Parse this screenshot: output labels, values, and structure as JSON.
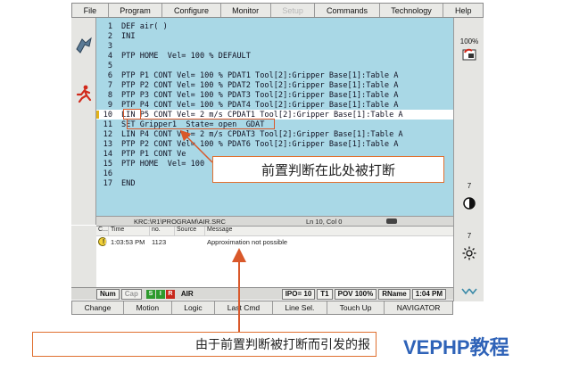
{
  "menu": [
    "File",
    "Program",
    "Configure",
    "Monitor",
    "Setup",
    "Commands",
    "Technology",
    "Help"
  ],
  "menu_active": "Setup",
  "program_lines": [
    {
      "n": "1",
      "code": "DEF air( )"
    },
    {
      "n": "2",
      "code": "INI"
    },
    {
      "n": "3",
      "code": ""
    },
    {
      "n": "4",
      "code": "PTP HOME  Vel= 100 % DEFAULT"
    },
    {
      "n": "5",
      "code": ""
    },
    {
      "n": "6",
      "code": "PTP P1 CONT Vel= 100 % PDAT1 Tool[2]:Gripper Base[1]:Table A"
    },
    {
      "n": "7",
      "code": "PTP P2 CONT Vel= 100 % PDAT2 Tool[2]:Gripper Base[1]:Table A"
    },
    {
      "n": "8",
      "code": "PTP P3 CONT Vel= 100 % PDAT3 Tool[2]:Gripper Base[1]:Table A"
    },
    {
      "n": "9",
      "code": "PTP P4 CONT Vel= 100 % PDAT4 Tool[2]:Gripper Base[1]:Table A"
    },
    {
      "n": "10",
      "code": "LIN P5 CONT Vel= 2 m/s CPDAT1 Tool[2]:Gripper Base[1]:Table A"
    },
    {
      "n": "11",
      "code": "SET Gripper1  State= open  GDAT"
    },
    {
      "n": "12",
      "code": "LIN P4 CONT Vel= 2 m/s CPDAT3 Tool[2]:Gripper Base[1]:Table A"
    },
    {
      "n": "13",
      "code": "PTP P2 CONT Vel= 100 % PDAT6 Tool[2]:Gripper Base[1]:Table A"
    },
    {
      "n": "14",
      "code": "PTP P1 CONT Ve"
    },
    {
      "n": "15",
      "code": "PTP HOME  Vel= 100"
    },
    {
      "n": "16",
      "code": ""
    },
    {
      "n": "17",
      "code": "END"
    }
  ],
  "current_line": "10",
  "callout_top": "前置判断在此处被打断",
  "path_bar": {
    "path": "KRC:\\R1\\PROGRAM\\AIR.SRC",
    "position": "Ln 10, Col 0"
  },
  "messages": {
    "headers": [
      "C...",
      "Time",
      "no.",
      "Source",
      "Message"
    ],
    "rows": [
      {
        "icon": "warning-icon",
        "time": "1:03:53 PM",
        "no": "1123",
        "source": "",
        "message": "Approximation not possible"
      }
    ]
  },
  "right_panel": {
    "override": "100%",
    "v1": "7",
    "v2": "7"
  },
  "status": {
    "num": "Num",
    "cap": "Cap",
    "s": "S",
    "i": "I",
    "r": "R",
    "air": "AIR",
    "ipo": "IPO= 10",
    "t1": "T1",
    "pov": "POV 100%",
    "rname": "RName",
    "time": "1:04 PM"
  },
  "softkeys": [
    "Change",
    "Motion",
    "Logic",
    "Last Cmd",
    "Line Sel.",
    "Touch Up",
    "NAVIGATOR"
  ],
  "callout_bottom": "由于前置判断被打断而引发的报",
  "watermark": "VEPHP教程",
  "colors": {
    "editor_bg": "#a9d8e6",
    "highlight_box": "#d9582a",
    "watermark": "#2f63b8"
  }
}
